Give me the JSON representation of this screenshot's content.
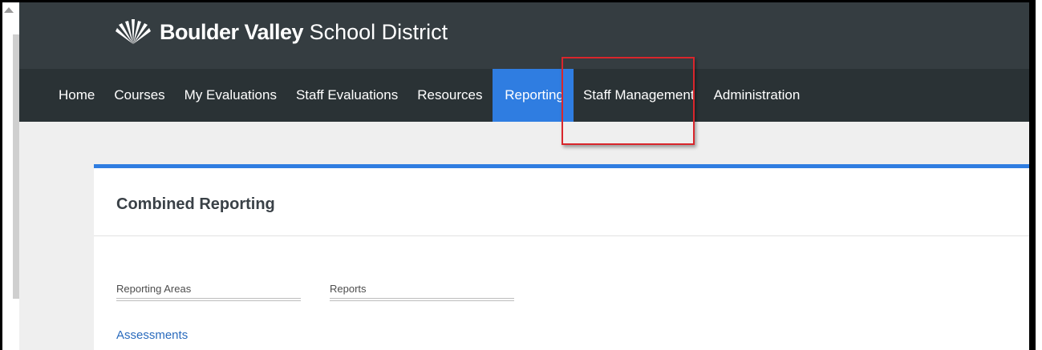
{
  "brand": {
    "name_bold": "Boulder Valley",
    "name_light": "School District",
    "colors": {
      "header": "#353d41",
      "nav": "#2a3235",
      "accent": "#2f7de1",
      "highlight": "#d9262c"
    }
  },
  "nav": {
    "items": [
      {
        "label": "Home"
      },
      {
        "label": "Courses"
      },
      {
        "label": "My Evaluations"
      },
      {
        "label": "Staff Evaluations"
      },
      {
        "label": "Resources"
      },
      {
        "label": "Reporting",
        "active": true
      },
      {
        "label": "Staff Management"
      },
      {
        "label": "Administration"
      }
    ]
  },
  "panel": {
    "title": "Combined Reporting",
    "tabs": [
      {
        "label": "Reporting Areas"
      },
      {
        "label": "Reports"
      }
    ],
    "links": [
      {
        "label": "Assessments"
      }
    ]
  },
  "icons": {
    "logo": "leaf-fan-logo-icon"
  }
}
